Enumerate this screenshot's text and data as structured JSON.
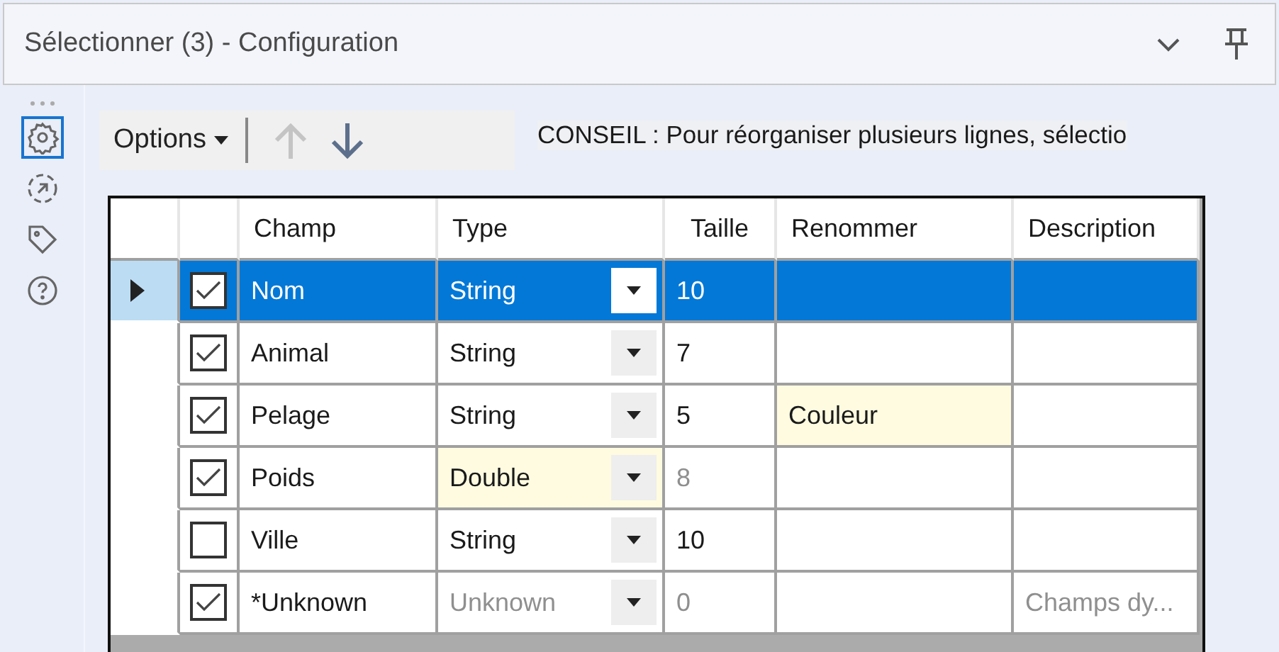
{
  "window": {
    "title": "Sélectionner (3) - Configuration"
  },
  "sidebar": {
    "items": [
      {
        "kind": "settings",
        "selected": true
      },
      {
        "kind": "output",
        "selected": false
      },
      {
        "kind": "tag",
        "selected": false
      },
      {
        "kind": "help",
        "selected": false
      }
    ]
  },
  "toolbar": {
    "options_label": "Options",
    "arrows": [
      {
        "kind": "up",
        "disabled": true
      },
      {
        "kind": "down",
        "disabled": false
      }
    ]
  },
  "hint": "CONSEIL : Pour réorganiser plusieurs lignes, sélectio",
  "table": {
    "columns": [
      "Champ",
      "Type",
      "Taille",
      "Renommer",
      "Description"
    ],
    "rows": [
      {
        "selected": true,
        "checked": true,
        "field": "Nom",
        "type": {
          "value": "String",
          "modified": false,
          "dimmed": false
        },
        "size": {
          "value": "10",
          "dimmed": false
        },
        "rename": {
          "modified": false
        }
      },
      {
        "selected": false,
        "checked": true,
        "field": "Animal",
        "type": {
          "value": "String",
          "modified": false,
          "dimmed": false
        },
        "size": {
          "value": "7",
          "dimmed": false
        },
        "rename": {
          "modified": false
        }
      },
      {
        "selected": false,
        "checked": true,
        "field": "Pelage",
        "type": {
          "value": "String",
          "modified": false,
          "dimmed": false
        },
        "size": {
          "value": "5",
          "dimmed": false
        },
        "rename": {
          "value": "Couleur",
          "modified": true
        }
      },
      {
        "selected": false,
        "checked": true,
        "field": "Poids",
        "type": {
          "value": "Double",
          "modified": true,
          "dimmed": false
        },
        "size": {
          "value": "8",
          "dimmed": true
        },
        "rename": {
          "modified": false
        }
      },
      {
        "selected": false,
        "checked": false,
        "field": "Ville",
        "type": {
          "value": "String",
          "modified": false,
          "dimmed": false
        },
        "size": {
          "value": "10",
          "dimmed": false
        },
        "rename": {
          "modified": false
        }
      },
      {
        "selected": false,
        "checked": true,
        "field": "*Unknown",
        "type": {
          "value": "Unknown",
          "modified": false,
          "dimmed": true
        },
        "size": {
          "value": "0",
          "dimmed": true
        },
        "rename": {
          "modified": false
        },
        "description": {
          "value": "Champs dy...",
          "dimmed": true
        }
      }
    ]
  }
}
